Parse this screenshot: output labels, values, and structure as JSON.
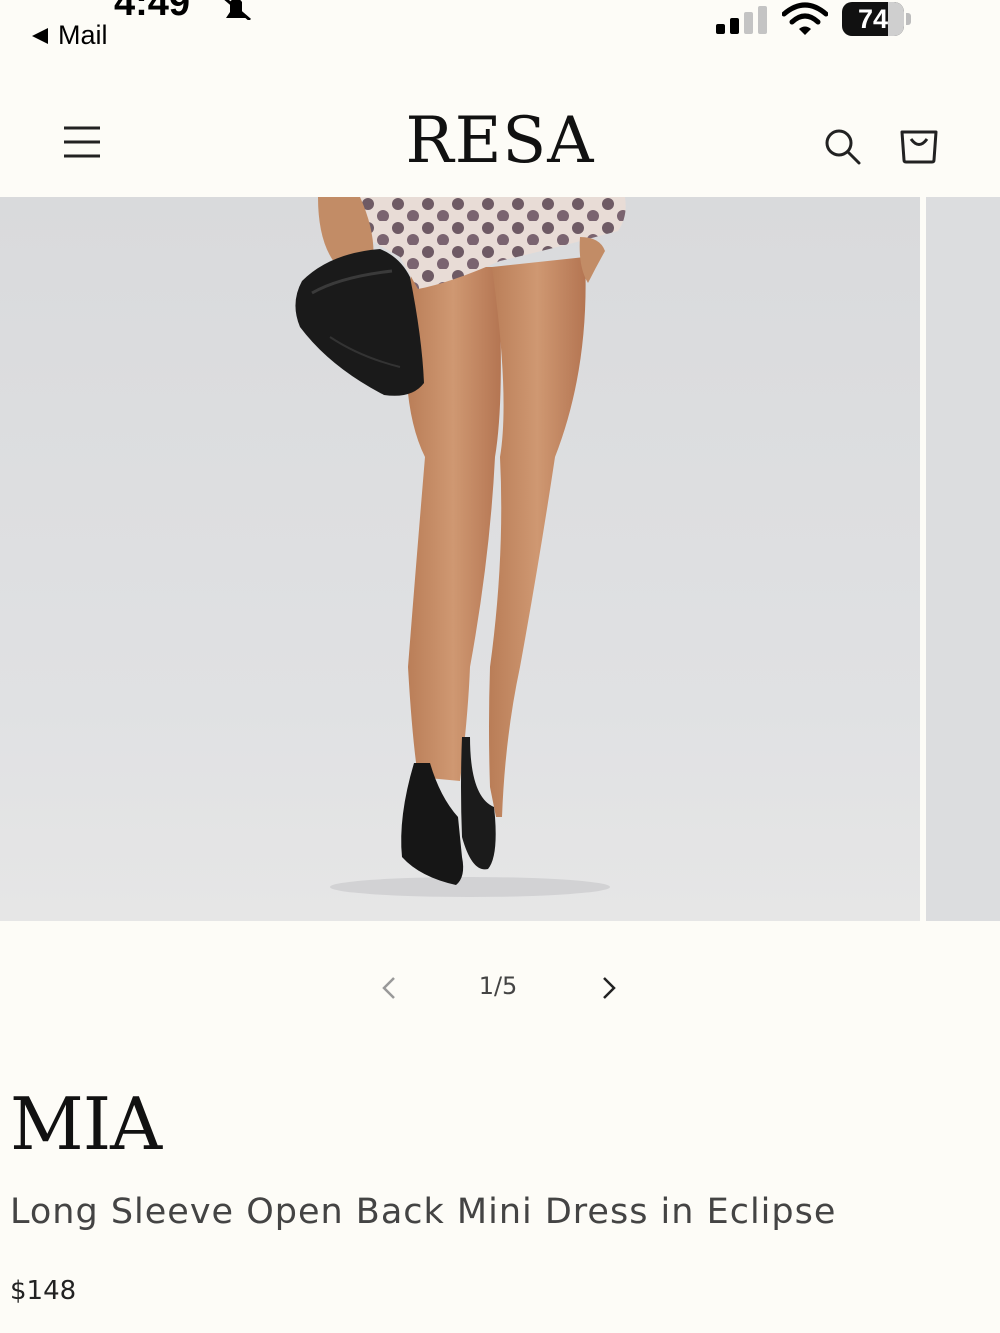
{
  "status_bar": {
    "time": "4:49",
    "back_label": "Mail",
    "battery_percent": 74,
    "battery_text": "74",
    "icons": [
      "bell-slash-icon",
      "signal-icon",
      "wifi-icon",
      "battery-icon"
    ]
  },
  "header": {
    "logo": "RESA",
    "icons": [
      "menu-icon",
      "search-icon",
      "cart-icon"
    ]
  },
  "gallery": {
    "counter": "1/5",
    "current": 1,
    "total": 5
  },
  "product": {
    "title": "MIA",
    "subtitle": "Long Sleeve Open Back Mini Dress in Eclipse",
    "price": "$148"
  },
  "colors": {
    "background": "#fdfcf7",
    "text": "#1a1a1a",
    "muted": "#444444"
  }
}
